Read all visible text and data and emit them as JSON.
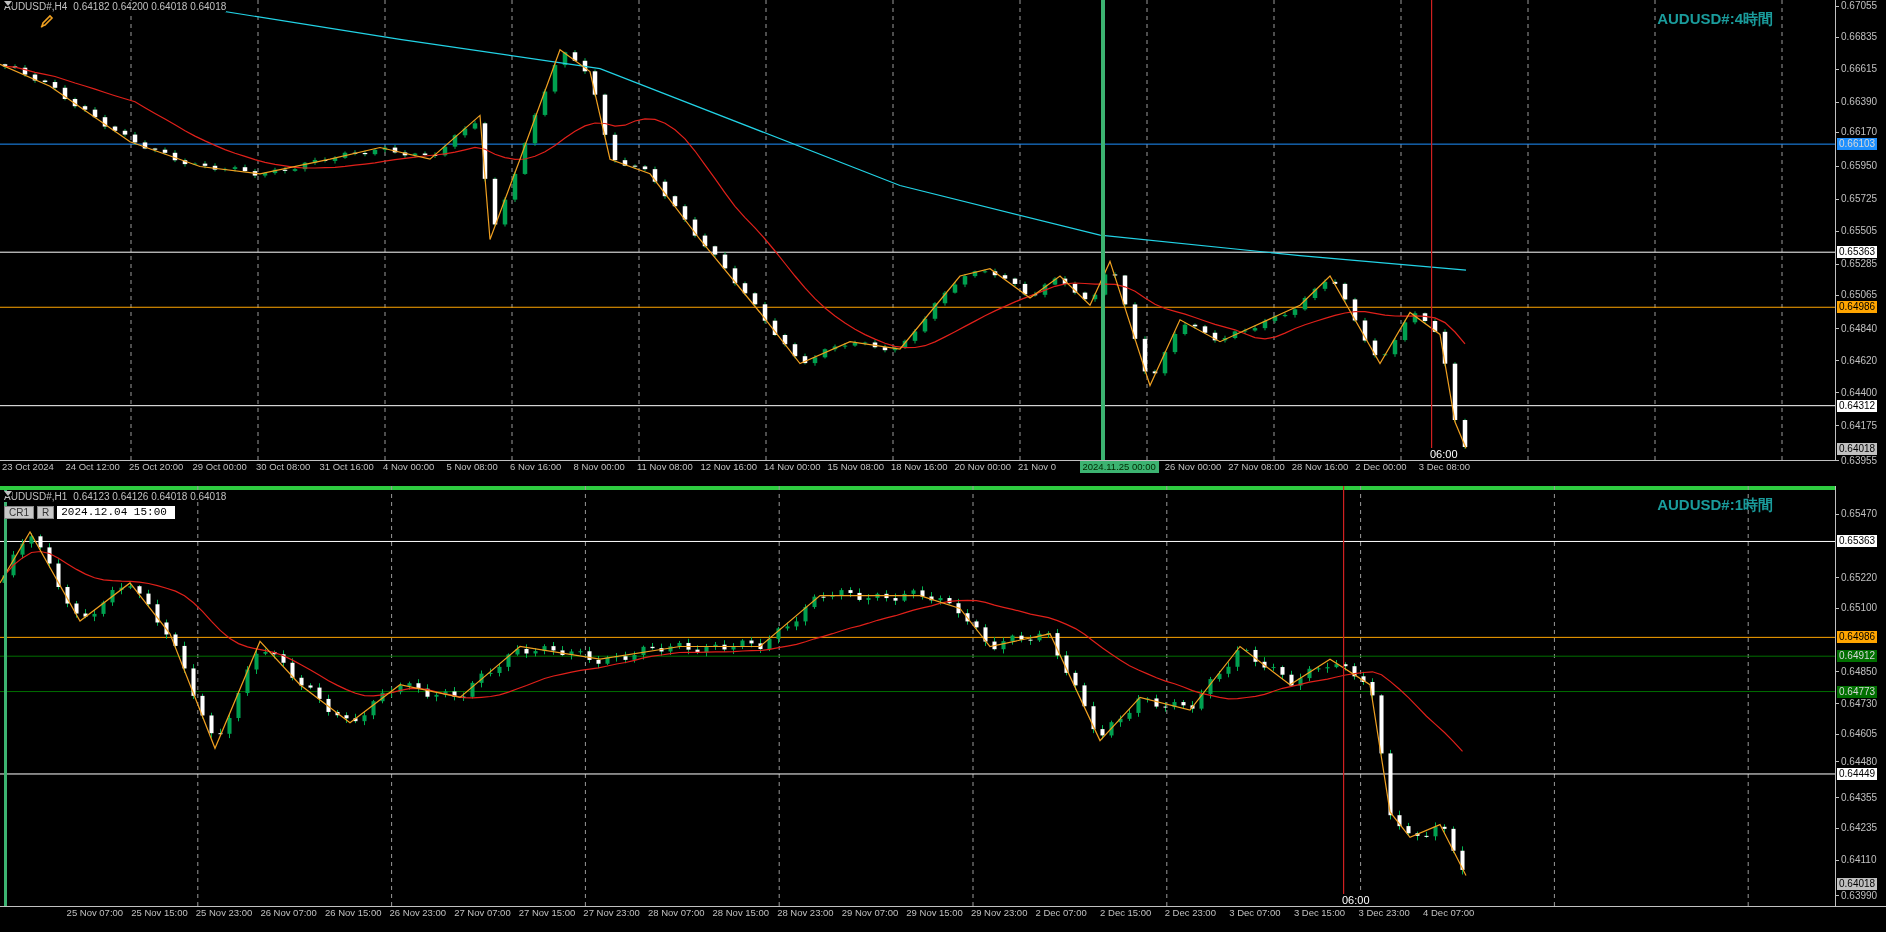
{
  "panes": [
    {
      "header": {
        "symbol": "AUDUSD#,H4",
        "ohlc": "0.64182 0.64200 0.64018 0.64018"
      },
      "title": "AUDUSD#:4時間",
      "price_ticks": [
        "0.67055",
        "0.66835",
        "0.66615",
        "0.66390",
        "0.66170",
        "0.65950",
        "0.65725",
        "0.65505",
        "0.65285",
        "0.65065",
        "0.64840",
        "0.64620",
        "0.64400",
        "0.64175",
        "0.63955"
      ],
      "level_lines": [
        {
          "price": "0.66103",
          "color": "#1e90ff",
          "kind": "line"
        },
        {
          "price": "0.65363",
          "color": "#ffffff",
          "kind": "line"
        },
        {
          "price": "0.64986",
          "color": "#ffa500",
          "kind": "line"
        },
        {
          "price": "0.64312",
          "color": "#ffffff",
          "kind": "line"
        },
        {
          "price": "0.64018",
          "color": "#c0c0c0",
          "kind": "current"
        }
      ],
      "time_labels": [
        {
          "text": "23 Oct 2024",
          "kind": "plain"
        },
        {
          "text": "24 Oct 12:00",
          "kind": "plain"
        },
        {
          "text": "25 Oct 20:00",
          "kind": "plain"
        },
        {
          "text": "29 Oct 00:00",
          "kind": "plain"
        },
        {
          "text": "30 Oct 08:00",
          "kind": "plain"
        },
        {
          "text": "31 Oct 16:00",
          "kind": "plain"
        },
        {
          "text": "4 Nov 00:00",
          "kind": "plain"
        },
        {
          "text": "5 Nov 08:00",
          "kind": "plain"
        },
        {
          "text": "6 Nov 16:00",
          "kind": "plain"
        },
        {
          "text": "8 Nov 00:00",
          "kind": "plain"
        },
        {
          "text": "11 Nov 08:00",
          "kind": "plain"
        },
        {
          "text": "12 Nov 16:00",
          "kind": "plain"
        },
        {
          "text": "14 Nov 00:00",
          "kind": "plain"
        },
        {
          "text": "15 Nov 08:00",
          "kind": "plain"
        },
        {
          "text": "18 Nov 16:00",
          "kind": "plain"
        },
        {
          "text": "20 Nov 00:00",
          "kind": "plain"
        },
        {
          "text": "21 Nov 0",
          "kind": "plain"
        },
        {
          "text": "2024.11.25 00:00",
          "kind": "highlight"
        },
        {
          "text": "26 Nov 00:00",
          "kind": "plain"
        },
        {
          "text": "27 Nov 08:00",
          "kind": "plain"
        },
        {
          "text": "28 Nov 16:00",
          "kind": "plain"
        },
        {
          "text": "2 Dec 00:00",
          "kind": "plain"
        },
        {
          "text": "3 Dec 08:00",
          "kind": "plain"
        }
      ],
      "cursor_time": "06:00"
    },
    {
      "header": {
        "symbol": "AUDUSD#,H1",
        "ohlc": "0.64123 0.64126 0.64018 0.64018"
      },
      "title": "AUDUSD#:1時間",
      "toolbar": {
        "buttons": [
          "CR1",
          "R"
        ],
        "date_field": "2024.12.04 15:00"
      },
      "price_ticks": [
        "0.65470",
        "0.65220",
        "0.65100",
        "0.64850",
        "0.64730",
        "0.64605",
        "0.64480",
        "0.64355",
        "0.64235",
        "0.64110",
        "0.63990"
      ],
      "level_lines": [
        {
          "price": "0.65363",
          "color": "#ffffff",
          "kind": "line"
        },
        {
          "price": "0.64986",
          "color": "#ffa500",
          "kind": "line"
        },
        {
          "price": "0.64912",
          "color": "#006f00",
          "kind": "line"
        },
        {
          "price": "0.64773",
          "color": "#006f00",
          "kind": "line"
        },
        {
          "price": "0.64449",
          "color": "#ffffff",
          "kind": "line"
        },
        {
          "price": "0.64018",
          "color": "#c0c0c0",
          "kind": "current"
        }
      ],
      "time_labels": [
        {
          "text": "25 Nov 07:00",
          "kind": "plain"
        },
        {
          "text": "25 Nov 15:00",
          "kind": "plain"
        },
        {
          "text": "25 Nov 23:00",
          "kind": "plain"
        },
        {
          "text": "26 Nov 07:00",
          "kind": "plain"
        },
        {
          "text": "26 Nov 15:00",
          "kind": "plain"
        },
        {
          "text": "26 Nov 23:00",
          "kind": "plain"
        },
        {
          "text": "27 Nov 07:00",
          "kind": "plain"
        },
        {
          "text": "27 Nov 15:00",
          "kind": "plain"
        },
        {
          "text": "27 Nov 23:00",
          "kind": "plain"
        },
        {
          "text": "28 Nov 07:00",
          "kind": "plain"
        },
        {
          "text": "28 Nov 15:00",
          "kind": "plain"
        },
        {
          "text": "28 Nov 23:00",
          "kind": "plain"
        },
        {
          "text": "29 Nov 07:00",
          "kind": "plain"
        },
        {
          "text": "29 Nov 15:00",
          "kind": "plain"
        },
        {
          "text": "29 Nov 23:00",
          "kind": "plain"
        },
        {
          "text": "2 Dec 07:00",
          "kind": "plain"
        },
        {
          "text": "2 Dec 15:00",
          "kind": "plain"
        },
        {
          "text": "2 Dec 23:00",
          "kind": "plain"
        },
        {
          "text": "3 Dec 07:00",
          "kind": "plain"
        },
        {
          "text": "3 Dec 15:00",
          "kind": "plain"
        },
        {
          "text": "3 Dec 23:00",
          "kind": "plain"
        },
        {
          "text": "4 Dec 07:00",
          "kind": "plain"
        }
      ],
      "cursor_time": "06:00"
    }
  ]
}
